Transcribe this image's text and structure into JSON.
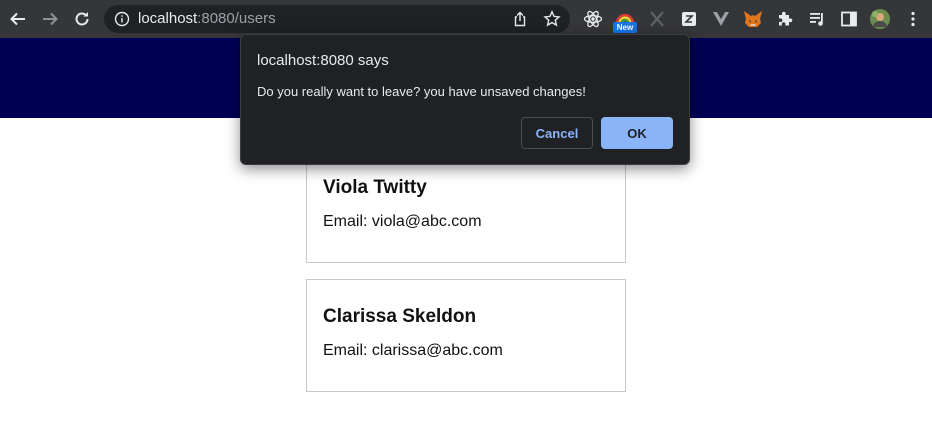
{
  "browser": {
    "url_host": "localhost",
    "url_rest": ":8080/users",
    "new_badge": "New"
  },
  "users": [
    {
      "name": "Viola Twitty",
      "email": "Email: viola@abc.com"
    },
    {
      "name": "Clarissa Skeldon",
      "email": "Email: clarissa@abc.com"
    }
  ],
  "dialog": {
    "title": "localhost:8080 says",
    "message": "Do you really want to leave? you have unsaved changes!",
    "cancel_label": "Cancel",
    "ok_label": "OK"
  },
  "colors": {
    "toolbar_bg": "#35363a",
    "nav_band": "#000055",
    "dialog_bg": "#202124",
    "accent": "#8ab4f8"
  }
}
